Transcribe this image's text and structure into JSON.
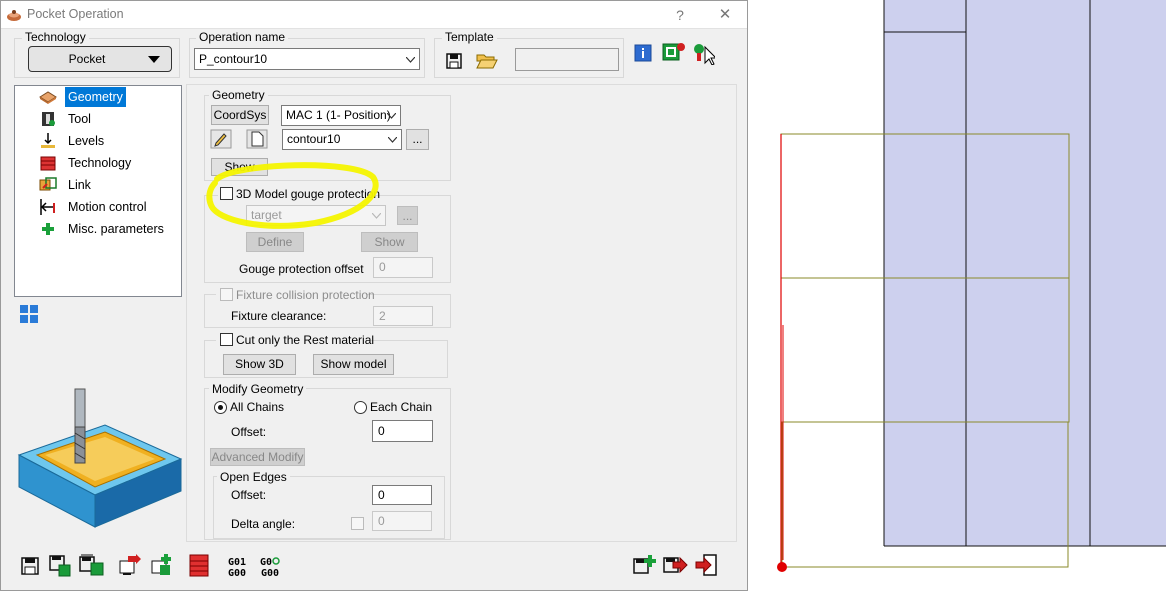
{
  "window": {
    "title": "Pocket Operation",
    "help_label": "?",
    "close_label": "✕"
  },
  "technology": {
    "label": "Technology",
    "value": "Pocket"
  },
  "operation_name": {
    "label": "Operation name",
    "value": "P_contour10"
  },
  "template": {
    "label": "Template",
    "value": ""
  },
  "tree": {
    "items": [
      {
        "label": "Geometry",
        "icon": "geometry-icon",
        "selected": true
      },
      {
        "label": "Tool",
        "icon": "tool-icon"
      },
      {
        "label": "Levels",
        "icon": "levels-icon"
      },
      {
        "label": "Technology",
        "icon": "technology-icon"
      },
      {
        "label": "Link",
        "icon": "link-icon"
      },
      {
        "label": "Motion control",
        "icon": "motion-control-icon"
      },
      {
        "label": "Misc. parameters",
        "icon": "misc-parameters-icon"
      }
    ]
  },
  "geometry": {
    "group_label": "Geometry",
    "coordsys_label": "CoordSys",
    "mac_value": "MAC 1 (1- Position)",
    "contour_value": "contour10",
    "browse_label": "...",
    "show_label": "Show"
  },
  "gouge": {
    "checkbox_label": "3D Model gouge protection",
    "target_value": "target",
    "browse_label": "...",
    "define_label": "Define",
    "show_label": "Show",
    "offset_label": "Gouge protection offset",
    "offset_value": "0"
  },
  "fixture": {
    "checkbox_label": "Fixture collision protection",
    "clearance_label": "Fixture clearance:",
    "clearance_value": "2"
  },
  "rest": {
    "checkbox_label": "Cut only the Rest material",
    "show3d_label": "Show 3D",
    "show_model_label": "Show model"
  },
  "modify": {
    "group_label": "Modify Geometry",
    "all_chains_label": "All Chains",
    "each_chain_label": "Each Chain",
    "offset_label": "Offset:",
    "offset_value": "0",
    "advanced_label": "Advanced Modify"
  },
  "open_edges": {
    "group_label": "Open Edges",
    "offset_label": "Offset:",
    "offset_value": "0",
    "delta_label": "Delta angle:",
    "delta_value": "0"
  },
  "gcode": {
    "g01": "G01",
    "g00": "G00",
    "g0": "G0",
    "g00b": "G00"
  },
  "colors": {
    "highlight": "#f4f400",
    "selection": "#0078d7",
    "viewport_fill": "#cdd0ee",
    "toolpath_red": "#e00000",
    "contour_olive": "#8a8a2a"
  }
}
